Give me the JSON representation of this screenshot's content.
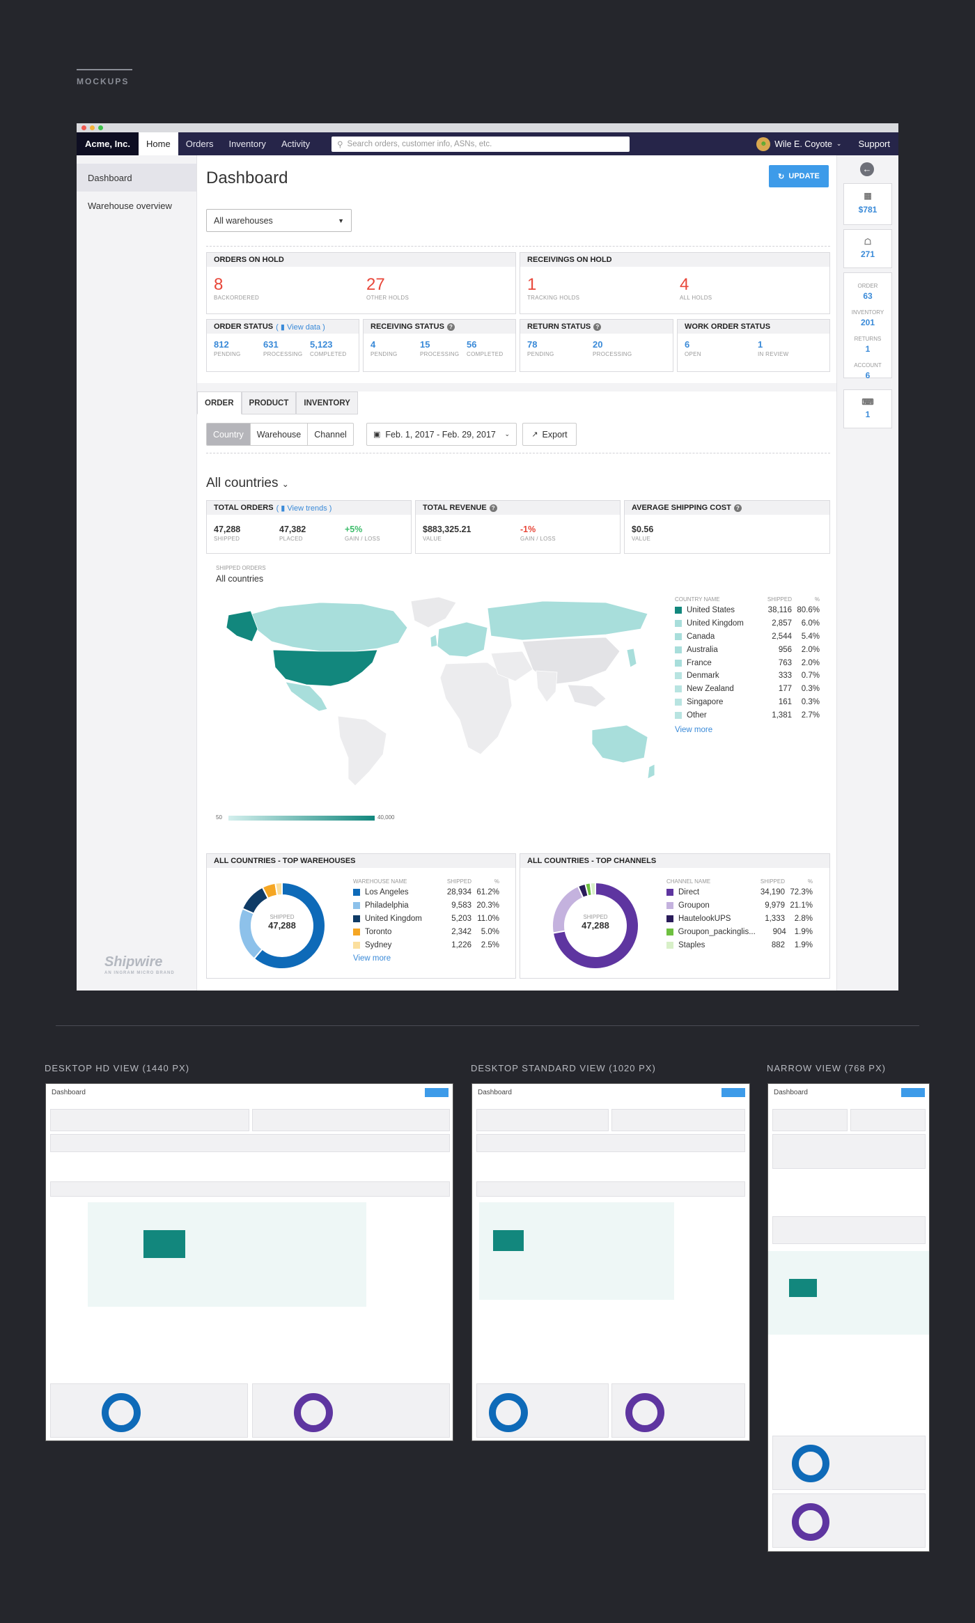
{
  "section_label": "MOCKUPS",
  "app": {
    "brand": "Acme, Inc.",
    "nav": [
      "Home",
      "Orders",
      "Inventory",
      "Activity"
    ],
    "search_placeholder": "Search orders, customer info, ASNs, etc.",
    "user": "Wile E. Coyote",
    "support": "Support"
  },
  "sidebar": {
    "items": [
      "Dashboard",
      "Warehouse overview"
    ],
    "logo": "Shipwire",
    "logo_sub": "AN INGRAM MICRO BRAND"
  },
  "page": {
    "title": "Dashboard",
    "update": "UPDATE",
    "warehouse_select": "All warehouses"
  },
  "orders_on_hold": {
    "title": "ORDERS ON HOLD",
    "items": [
      {
        "value": "8",
        "label": "BACKORDERED"
      },
      {
        "value": "27",
        "label": "OTHER HOLDS"
      }
    ]
  },
  "receivings_on_hold": {
    "title": "RECEIVINGS ON HOLD",
    "items": [
      {
        "value": "1",
        "label": "TRACKING HOLDS"
      },
      {
        "value": "4",
        "label": "ALL HOLDS"
      }
    ]
  },
  "order_status": {
    "title": "ORDER STATUS",
    "link": "View data",
    "items": [
      {
        "value": "812",
        "label": "PENDING"
      },
      {
        "value": "631",
        "label": "PROCESSING"
      },
      {
        "value": "5,123",
        "label": "COMPLETED"
      }
    ]
  },
  "receiving_status": {
    "title": "RECEIVING STATUS",
    "items": [
      {
        "value": "4",
        "label": "PENDING"
      },
      {
        "value": "15",
        "label": "PROCESSING"
      },
      {
        "value": "56",
        "label": "COMPLETED"
      }
    ]
  },
  "return_status": {
    "title": "RETURN STATUS",
    "items": [
      {
        "value": "78",
        "label": "PENDING"
      },
      {
        "value": "20",
        "label": "PROCESSING"
      }
    ]
  },
  "work_order_status": {
    "title": "WORK ORDER STATUS",
    "items": [
      {
        "value": "6",
        "label": "OPEN"
      },
      {
        "value": "1",
        "label": "IN REVIEW"
      }
    ]
  },
  "tabs": [
    "ORDER",
    "PRODUCT",
    "INVENTORY"
  ],
  "filters": {
    "segments": [
      "Country",
      "Warehouse",
      "Channel"
    ],
    "date_range": "Feb. 1, 2017 - Feb. 29, 2017",
    "export": "Export"
  },
  "region": "All countries",
  "total_orders": {
    "title": "TOTAL ORDERS",
    "link": "View trends",
    "items": [
      {
        "value": "47,288",
        "label": "SHIPPED"
      },
      {
        "value": "47,382",
        "label": "PLACED"
      },
      {
        "value": "+5%",
        "label": "GAIN / LOSS"
      }
    ]
  },
  "total_revenue": {
    "title": "TOTAL REVENUE",
    "items": [
      {
        "value": "$883,325.21",
        "label": "VALUE"
      },
      {
        "value": "-1%",
        "label": "GAIN / LOSS"
      }
    ]
  },
  "avg_shipping": {
    "title": "AVERAGE SHIPPING COST",
    "items": [
      {
        "value": "$0.56",
        "label": "VALUE"
      }
    ]
  },
  "map": {
    "caption": "SHIPPED ORDERS",
    "subtitle": "All countries",
    "legend_min": "50",
    "legend_max": "40,000",
    "table_headers": [
      "COUNTRY NAME",
      "SHIPPED",
      "%"
    ],
    "countries": [
      {
        "name": "United States",
        "shipped": "38,116",
        "pct": "80.6%",
        "color": "#12877d"
      },
      {
        "name": "United Kingdom",
        "shipped": "2,857",
        "pct": "6.0%",
        "color": "#a8dedb"
      },
      {
        "name": "Canada",
        "shipped": "2,544",
        "pct": "5.4%",
        "color": "#a8dedb"
      },
      {
        "name": "Australia",
        "shipped": "956",
        "pct": "2.0%",
        "color": "#a8dedb"
      },
      {
        "name": "France",
        "shipped": "763",
        "pct": "2.0%",
        "color": "#a8dedb"
      },
      {
        "name": "Denmark",
        "shipped": "333",
        "pct": "0.7%",
        "color": "#b8e4e1"
      },
      {
        "name": "New Zealand",
        "shipped": "177",
        "pct": "0.3%",
        "color": "#b8e4e1"
      },
      {
        "name": "Singapore",
        "shipped": "161",
        "pct": "0.3%",
        "color": "#b8e4e1"
      },
      {
        "name": "Other",
        "shipped": "1,381",
        "pct": "2.7%",
        "color": "#b8e4e1"
      }
    ],
    "view_more": "View more"
  },
  "top_warehouses": {
    "title": "ALL COUNTRIES - TOP WAREHOUSES",
    "center_label": "SHIPPED",
    "center_value": "47,288",
    "headers": [
      "WAREHOUSE NAME",
      "SHIPPED",
      "%"
    ],
    "rows": [
      {
        "name": "Los Angeles",
        "shipped": "28,934",
        "pct": "61.2%",
        "value": 61.2,
        "color": "#0e6ab8"
      },
      {
        "name": "Philadelphia",
        "shipped": "9,583",
        "pct": "20.3%",
        "value": 20.3,
        "color": "#8dc1ea"
      },
      {
        "name": "United Kingdom",
        "shipped": "5,203",
        "pct": "11.0%",
        "value": 11.0,
        "color": "#0f3b66"
      },
      {
        "name": "Toronto",
        "shipped": "2,342",
        "pct": "5.0%",
        "value": 5.0,
        "color": "#f5a623"
      },
      {
        "name": "Sydney",
        "shipped": "1,226",
        "pct": "2.5%",
        "value": 2.5,
        "color": "#fbdf9e"
      }
    ],
    "view_more": "View more"
  },
  "top_channels": {
    "title": "ALL COUNTRIES - TOP CHANNELS",
    "center_label": "SHIPPED",
    "center_value": "47,288",
    "headers": [
      "CHANNEL NAME",
      "SHIPPED",
      "%"
    ],
    "rows": [
      {
        "name": "Direct",
        "shipped": "34,190",
        "pct": "72.3%",
        "value": 72.3,
        "color": "#5e35a0"
      },
      {
        "name": "Groupon",
        "shipped": "9,979",
        "pct": "21.1%",
        "value": 21.1,
        "color": "#c4b2de"
      },
      {
        "name": "HautelookUPS",
        "shipped": "1,333",
        "pct": "2.8%",
        "value": 2.8,
        "color": "#2a1c5a"
      },
      {
        "name": "Groupon_packinglis...",
        "shipped": "904",
        "pct": "1.9%",
        "value": 1.9,
        "color": "#6ec040"
      },
      {
        "name": "Staples",
        "shipped": "882",
        "pct": "1.9%",
        "value": 1.9,
        "color": "#d8f0c8"
      }
    ]
  },
  "right_rail": {
    "balance": "$781",
    "notifications": "271",
    "order_label": "ORDER",
    "order": "63",
    "inventory_label": "INVENTORY",
    "inventory": "201",
    "returns_label": "RETURNS",
    "returns": "1",
    "account_label": "ACCOUNT",
    "account": "6",
    "keyboard": "1"
  },
  "views": [
    "DESKTOP HD VIEW (1440 PX)",
    "DESKTOP STANDARD VIEW (1020 PX)",
    "NARROW VIEW (768 PX)"
  ]
}
